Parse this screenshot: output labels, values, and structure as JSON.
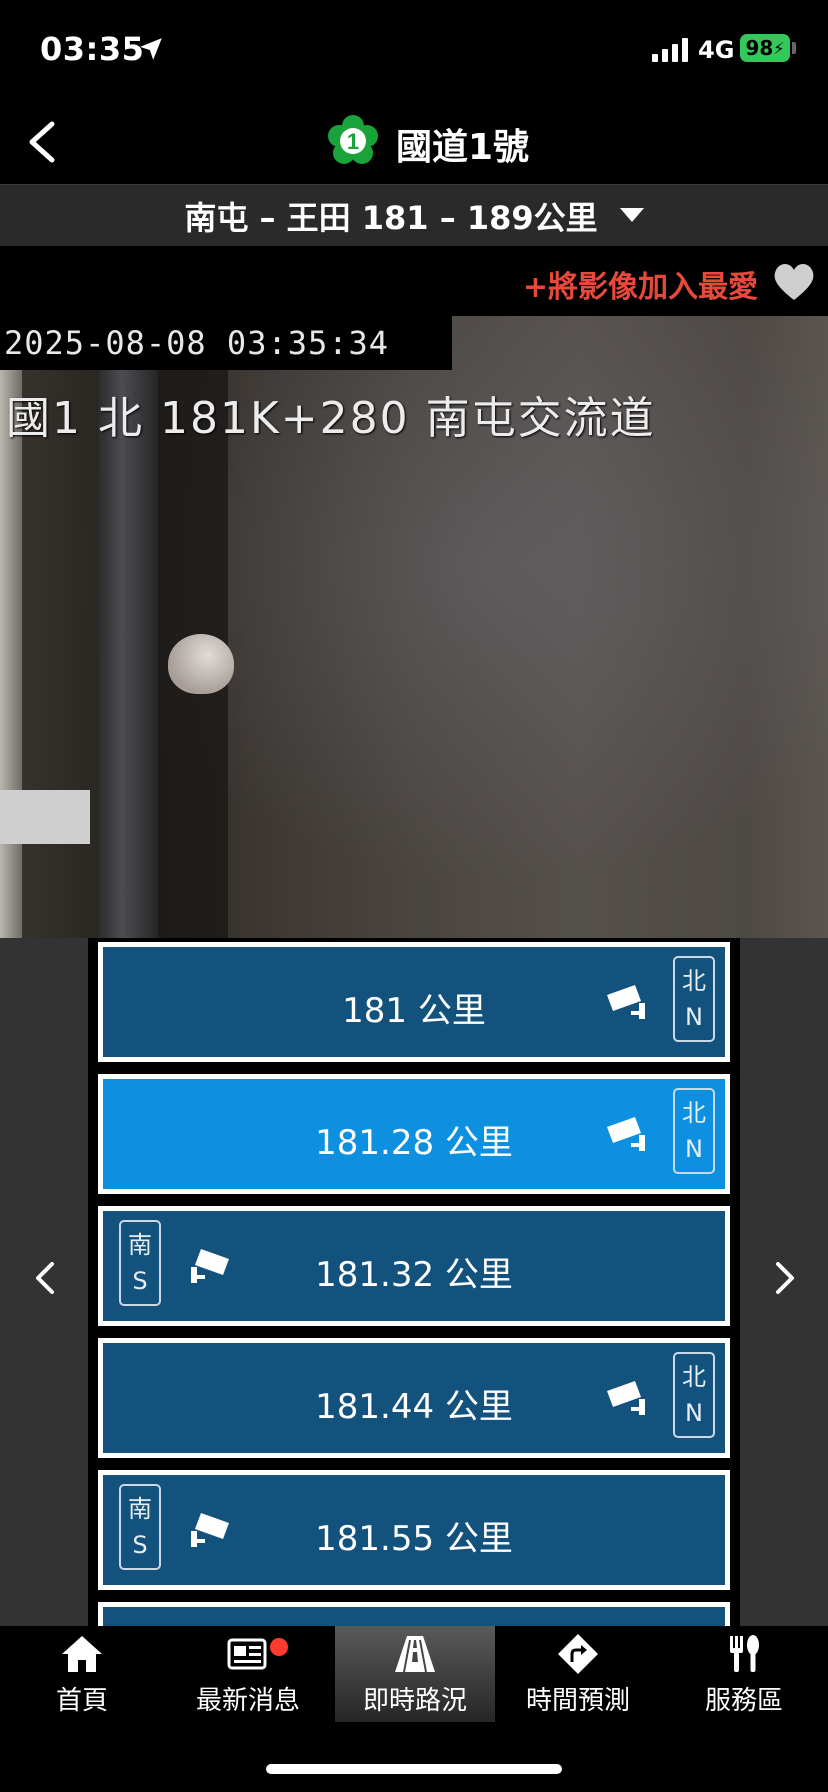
{
  "status_bar": {
    "time": "03:35",
    "network": "4G",
    "battery": "98"
  },
  "header": {
    "title": "國道1號",
    "route_number": "1"
  },
  "section": {
    "label": "南屯 – 王田 181 – 189公里"
  },
  "favorite": {
    "label": "+將影像加入最愛"
  },
  "camera": {
    "timestamp": "2025-08-08 03:35:34",
    "location": "國1 北 181K+280 南屯交流道"
  },
  "cameras": [
    {
      "km": "181 公里",
      "dir_zh": "北",
      "dir_en": "N",
      "side": "right",
      "active": false
    },
    {
      "km": "181.28 公里",
      "dir_zh": "北",
      "dir_en": "N",
      "side": "right",
      "active": true
    },
    {
      "km": "181.32 公里",
      "dir_zh": "南",
      "dir_en": "S",
      "side": "left",
      "active": false
    },
    {
      "km": "181.44 公里",
      "dir_zh": "北",
      "dir_en": "N",
      "side": "right",
      "active": false
    },
    {
      "km": "181.55 公里",
      "dir_zh": "南",
      "dir_en": "S",
      "side": "left",
      "active": false
    }
  ],
  "tabs": [
    {
      "label": "首頁",
      "icon": "home-icon"
    },
    {
      "label": "最新消息",
      "icon": "news-icon"
    },
    {
      "label": "即時路況",
      "icon": "road-icon"
    },
    {
      "label": "時間預測",
      "icon": "route-turn-icon"
    },
    {
      "label": "服務區",
      "icon": "utensils-icon"
    }
  ],
  "colors": {
    "accent_red": "#e74a3b",
    "item_blue": "#14527e",
    "item_active": "#0d90e0",
    "badge_green": "#1aa33a",
    "battery_green": "#34c759"
  }
}
